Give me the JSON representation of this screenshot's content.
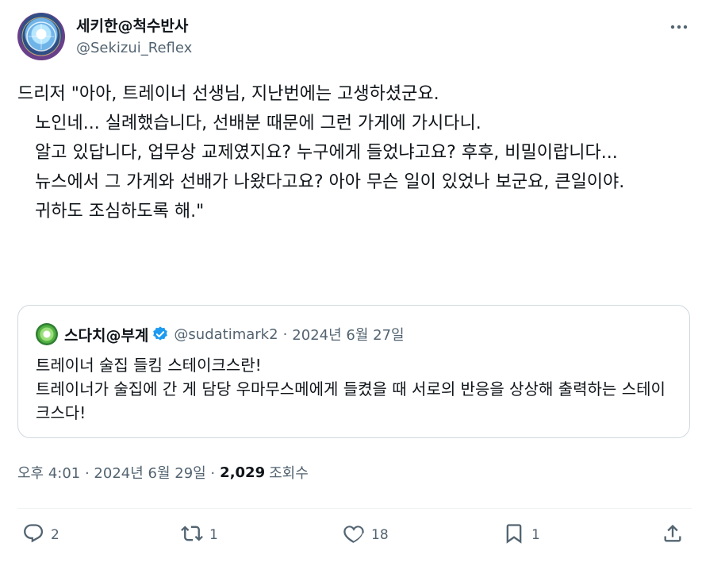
{
  "author": {
    "display_name": "세키한@척수반사",
    "handle": "@Sekizui_Reflex"
  },
  "tweet_text": "드리저 \"아아, 트레이너 선생님, 지난번에는 고생하셨군요.\n　노인네... 실례했습니다, 선배분 때문에 그런 가게에 가시다니.\n　알고 있답니다, 업무상 교제였지요? 누구에게 들었냐고요? 후후, 비밀이랍니다...\n　뉴스에서 그 가게와 선배가 나왔다고요? 아아 무슨 일이 있었나 보군요, 큰일이야.\n　귀하도 조심하도록 해.\"",
  "quoted_tweet": {
    "display_name": "스다치@부계",
    "handle": "@sudatimark2",
    "separator": "·",
    "date": "2024년 6월 27일",
    "text": "트레이너 술집 들킴 스테이크스란!\n트레이너가 술집에 간 게 담당 우마무스메에게 들켰을 때 서로의 반응을 상상해 출력하는 스테이크스다!"
  },
  "meta": {
    "time_date": "오후 4:01 · 2024년 6월 29일 ·",
    "views_count": "2,029",
    "views_label": "조회수"
  },
  "actions": {
    "replies": "2",
    "retweets": "1",
    "likes": "18",
    "bookmarks": "1"
  },
  "icons": {
    "more": "more-icon",
    "reply": "reply-icon",
    "retweet": "retweet-icon",
    "like": "heart-icon",
    "bookmark": "bookmark-icon",
    "share": "share-icon",
    "verified": "verified-badge-icon"
  },
  "colors": {
    "text": "#0f1419",
    "secondary": "#536471",
    "border": "#cfd9de",
    "verified": "#1d9bf0"
  }
}
